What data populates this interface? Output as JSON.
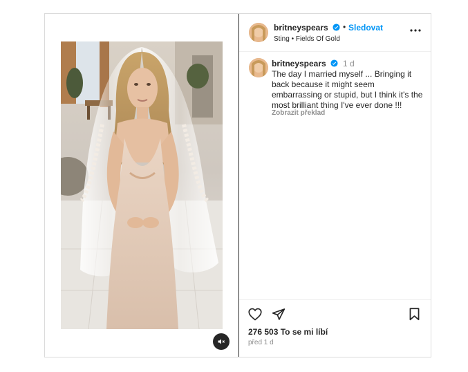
{
  "post": {
    "username": "britneyspears",
    "follow_label": "Sledovat",
    "audio": "Sting • Fields Of Gold",
    "caption": {
      "username": "britneyspears",
      "time": "1 d",
      "text": "The day I married myself ... Bringing it back because it might seem embarrassing or stupid, but I think it's the most brilliant thing I've ever done !!!",
      "translate_label": "Zobrazit překlad"
    },
    "likes": "276 503 To se mi líbí",
    "date": "před 1 d"
  },
  "icons": {
    "verified": "verified-badge-icon",
    "more": "more-options-icon",
    "like": "heart-icon",
    "share": "share-icon",
    "save": "bookmark-icon",
    "mute": "muted-speaker-icon"
  },
  "colors": {
    "link": "#0095f6",
    "text": "#262626",
    "secondary": "#8e8e8e",
    "border": "#dbdbdb"
  }
}
